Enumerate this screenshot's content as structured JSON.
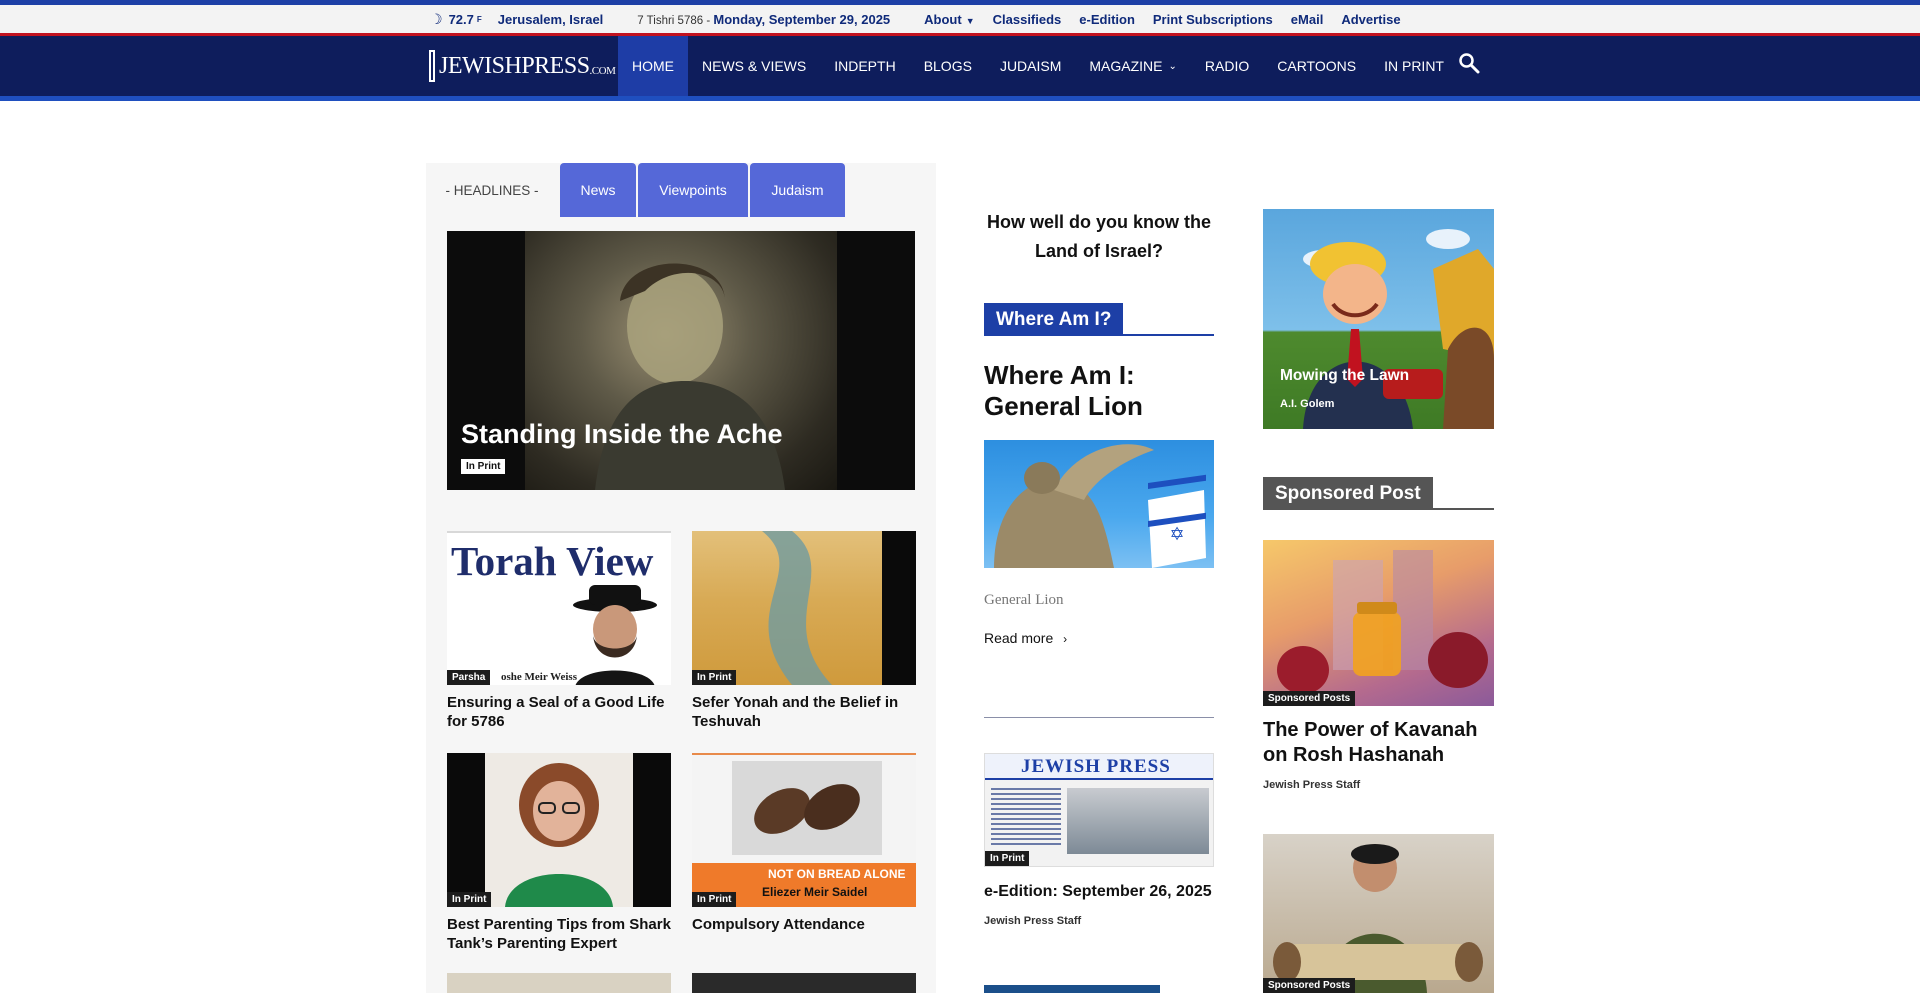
{
  "topbar": {
    "temperature": "72.7",
    "degree": "F",
    "location": "Jerusalem, Israel",
    "hebrew_date": "7 Tishri 5786 -",
    "date": "Monday, September 29, 2025",
    "links": [
      "About",
      "Classifieds",
      "e-Edition",
      "Print Subscriptions",
      "eMail",
      "Advertise"
    ]
  },
  "nav": {
    "logo_text": "JEWISHPRESS",
    "logo_suffix": ".COM",
    "items": [
      "HOME",
      "NEWS & VIEWS",
      "INDEPTH",
      "BLOGS",
      "JUDAISM",
      "MAGAZINE",
      "RADIO",
      "CARTOONS",
      "IN PRINT"
    ]
  },
  "headlines": {
    "label": "- HEADLINES -",
    "tabs": [
      "News",
      "Viewpoints",
      "Judaism"
    ],
    "hero": {
      "title": "Standing Inside the Ache",
      "category": "In Print"
    },
    "cards": [
      {
        "title": "Ensuring a Seal of a Good Life for 5786",
        "category": "Parsha",
        "thumb_text": "Torah View",
        "thumb_caption": "oshe Meir Weiss"
      },
      {
        "title": "Sefer Yonah and the Belief in Teshuvah",
        "category": "In Print"
      },
      {
        "title": "Best Parenting Tips from Shark Tank’s Parenting Expert",
        "category": "In Print"
      },
      {
        "title": "Compulsory Attendance",
        "category": "In Print",
        "thumb_text": "NOT ON BREAD ALONE",
        "thumb_caption": "Eliezer Meir Saidel"
      }
    ]
  },
  "middle": {
    "quiz_title": "How well do you know the Land of Israel?",
    "section_label": "Where Am I?",
    "post_title": "Where Am I: General Lion",
    "post_subtitle": "General Lion",
    "read_more": "Read more",
    "edition": {
      "title": "e-Edition: September 26, 2025",
      "byline": "Jewish Press Staff",
      "category": "In Print",
      "masthead": "JEWISH PRESS"
    }
  },
  "right": {
    "cartoon": {
      "title": "Mowing the Lawn",
      "byline": "A.I. Golem"
    },
    "sponsored_label": "Sponsored Post",
    "sponsored": {
      "title": "The Power of Kavanah on Rosh Hashanah",
      "byline": "Jewish Press Staff",
      "category": "Sponsored Posts"
    },
    "sponsored2": {
      "category": "Sponsored Posts"
    }
  },
  "colors": {
    "nav_bg": "#0e1d5c",
    "accent_blue": "#1d3fa6",
    "tab_blue": "#5568d8",
    "accent_red": "#c1121f",
    "sponsored_gray": "#555555"
  }
}
